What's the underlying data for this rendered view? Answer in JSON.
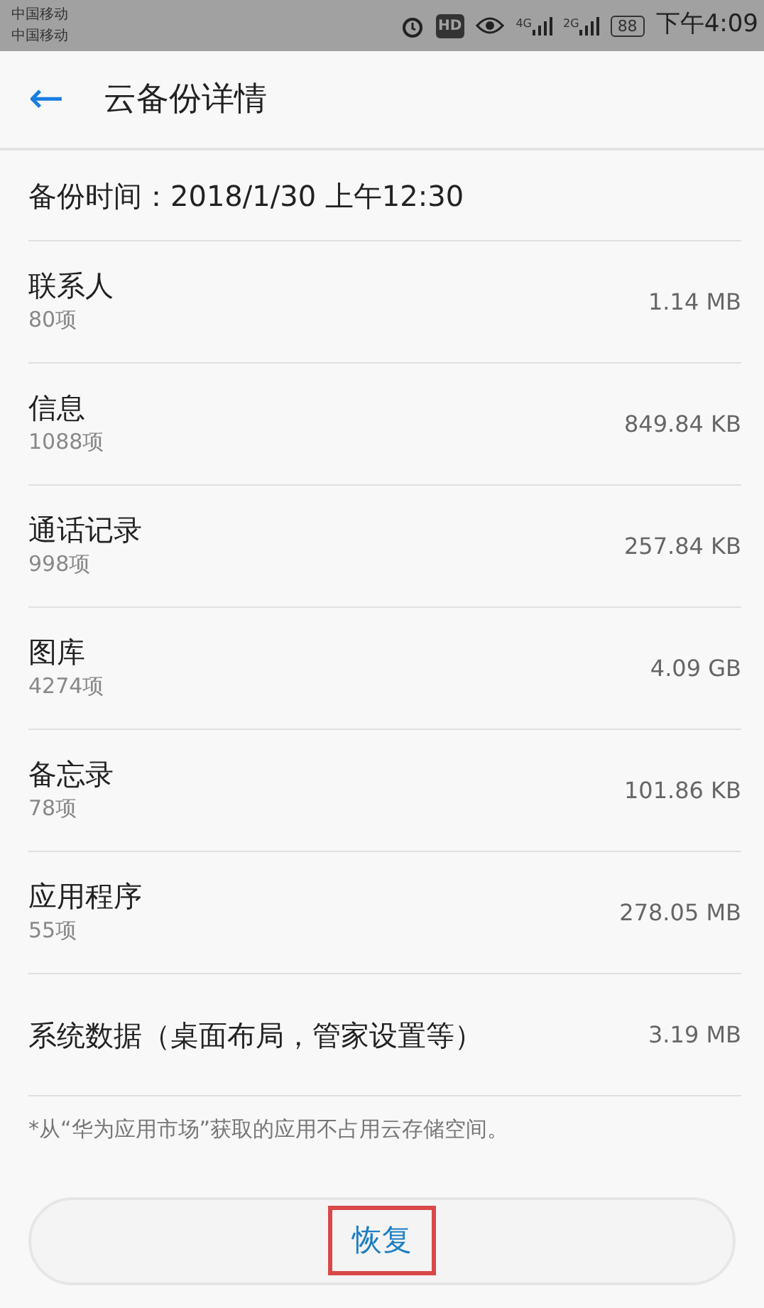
{
  "status_bar": {
    "carriers": [
      "中国移动",
      "中国移动"
    ],
    "hd": "HD",
    "network_1": "4G",
    "network_2": "2G",
    "battery": "88",
    "time": "下午4:09"
  },
  "header": {
    "back": "←",
    "title": "云备份详情"
  },
  "backup_time": "备份时间：2018/1/30 上午12:30",
  "items": [
    {
      "name": "联系人",
      "count": "80项",
      "size": "1.14 MB"
    },
    {
      "name": "信息",
      "count": "1088项",
      "size": "849.84 KB"
    },
    {
      "name": "通话记录",
      "count": "998项",
      "size": "257.84 KB"
    },
    {
      "name": "图库",
      "count": "4274项",
      "size": "4.09 GB"
    },
    {
      "name": "备忘录",
      "count": "78项",
      "size": "101.86 KB"
    },
    {
      "name": "应用程序",
      "count": "55项",
      "size": "278.05 MB"
    }
  ],
  "system_data": {
    "name": "系统数据（桌面布局，管家设置等）",
    "size": "3.19 MB"
  },
  "footnote": "*从“华为应用市场”获取的应用不占用云存储空间。",
  "restore_button": {
    "label": "恢复",
    "highlighted": true
  }
}
